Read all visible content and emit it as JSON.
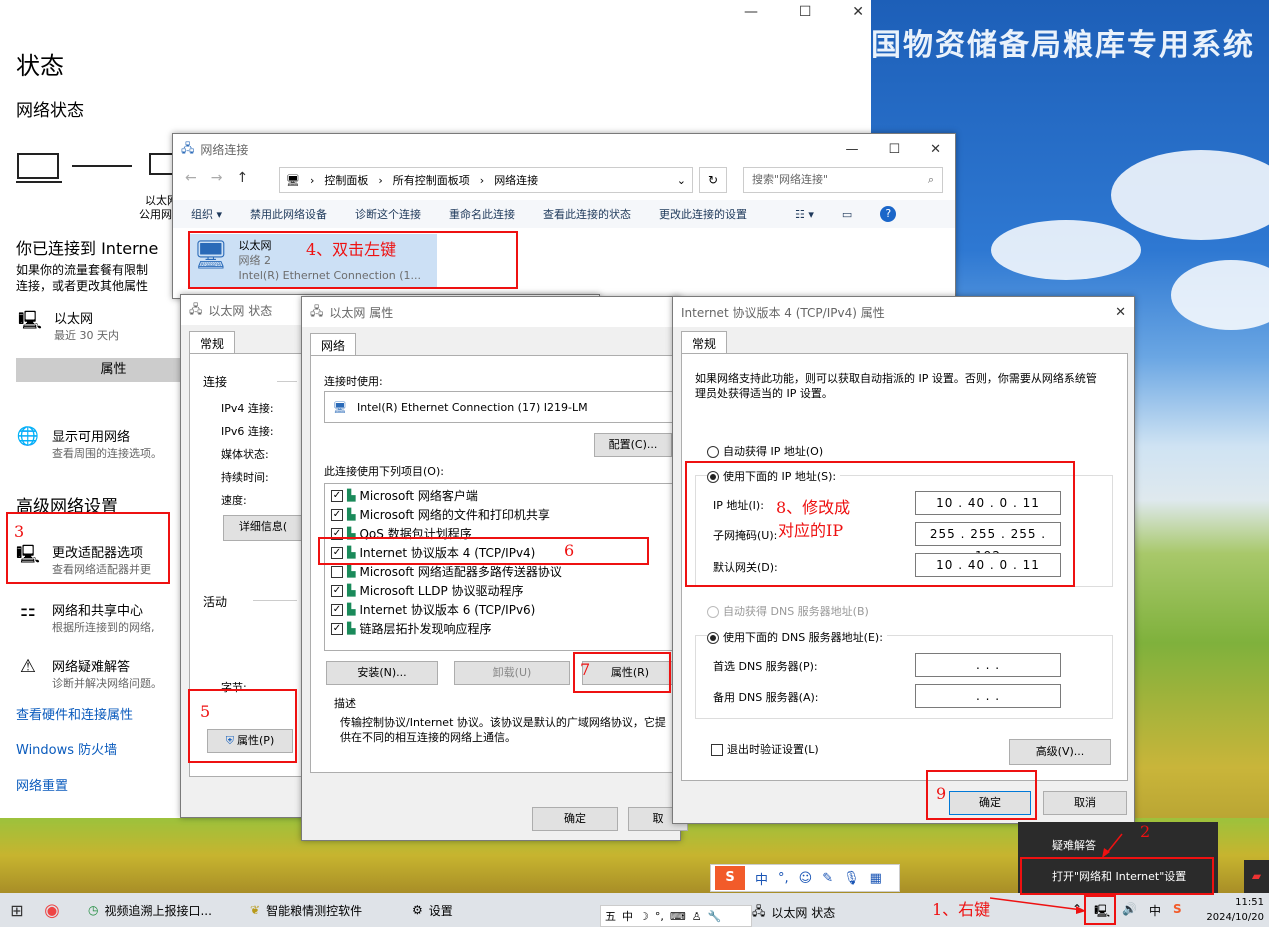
{
  "banner": "国物资储备局粮库专用系统",
  "settings": {
    "heading": "状态",
    "network_status": "网络状态",
    "adapter_label": "以太网",
    "adapter_sub": "公用网",
    "connected_heading": "你已连接到 Interne",
    "connected_desc1": "如果你的流量套餐有限制",
    "connected_desc2": "连接，或者更改其他属性",
    "eth_name": "以太网",
    "eth_sub": "最近 30 天内",
    "props_btn": "属性",
    "show_networks": "显示可用网络",
    "show_networks_sub": "查看周围的连接选项。",
    "advanced_heading": "高级网络设置",
    "change_adapter": "更改适配器选项",
    "change_adapter_sub": "查看网络适配器并更",
    "sharing_center": "网络和共享中心",
    "sharing_center_sub": "根据所连接到的网络,",
    "troubleshoot": "网络疑难解答",
    "troubleshoot_sub": "诊断并解决网络问题。",
    "link_hw": "查看硬件和连接属性",
    "link_firewall": "Windows 防火墙",
    "link_reset": "网络重置"
  },
  "netconn": {
    "title": "网络连接",
    "breadcrumb": [
      "控制面板",
      "所有控制面板项",
      "网络连接"
    ],
    "search_placeholder": "搜索\"网络连接\"",
    "toolbar": [
      "组织 ▾",
      "禁用此网络设备",
      "诊断这个连接",
      "重命名此连接",
      "查看此连接的状态",
      "更改此连接的设置"
    ],
    "adapter": {
      "name": "以太网",
      "net": "网络 2",
      "device": "Intel(R) Ethernet Connection (1..."
    }
  },
  "status_win": {
    "title": "以太网 状态",
    "tab": "常规",
    "group_conn": "连接",
    "rows": [
      "IPv4 连接:",
      "IPv6 连接:",
      "媒体状态:",
      "持续时间:",
      "速度:"
    ],
    "details_btn": "详细信息(",
    "group_activity": "活动",
    "bytes": "字节:",
    "props_btn": "属性(P)"
  },
  "props_win": {
    "title": "以太网 属性",
    "tab": "网络",
    "connect_using": "连接时使用:",
    "device": "Intel(R) Ethernet Connection (17) I219-LM",
    "config_btn": "配置(C)...",
    "items_label": "此连接使用下列项目(O):",
    "items": [
      {
        "checked": true,
        "label": "Microsoft 网络客户端"
      },
      {
        "checked": true,
        "label": "Microsoft 网络的文件和打印机共享"
      },
      {
        "checked": true,
        "label": "QoS 数据包计划程序"
      },
      {
        "checked": true,
        "label": "Internet 协议版本 4 (TCP/IPv4)"
      },
      {
        "checked": false,
        "label": "Microsoft 网络适配器多路传送器协议"
      },
      {
        "checked": true,
        "label": "Microsoft LLDP 协议驱动程序"
      },
      {
        "checked": true,
        "label": "Internet 协议版本 6 (TCP/IPv6)"
      },
      {
        "checked": true,
        "label": "链路层拓扑发现响应程序"
      }
    ],
    "install_btn": "安装(N)...",
    "uninstall_btn": "卸载(U)",
    "props_btn": "属性(R)",
    "desc_label": "描述",
    "desc": "传输控制协议/Internet 协议。该协议是默认的广域网络协议，它提供在不同的相互连接的网络上通信。",
    "ok_btn": "确定",
    "cancel_btn": "取"
  },
  "ipv4": {
    "title": "Internet 协议版本 4 (TCP/IPv4) 属性",
    "tab": "常规",
    "intro": "如果网络支持此功能，则可以获取自动指派的 IP 设置。否则，你需要从网络系统管理员处获得适当的 IP 设置。",
    "auto_ip": "自动获得 IP 地址(O)",
    "manual_ip": "使用下面的 IP 地址(S):",
    "ip_label": "IP 地址(I):",
    "mask_label": "子网掩码(U):",
    "gw_label": "默认网关(D):",
    "ip": "10 . 40 . 0 . 11",
    "mask": "255 . 255 . 255 . 192",
    "gw": "10 . 40 . 0 . 11",
    "auto_dns": "自动获得 DNS 服务器地址(B)",
    "manual_dns": "使用下面的 DNS 服务器地址(E):",
    "dns1_label": "首选 DNS 服务器(P):",
    "dns2_label": "备用 DNS 服务器(A):",
    "dns_empty": ".      .      .",
    "validate": "退出时验证设置(L)",
    "advanced_btn": "高级(V)...",
    "ok_btn": "确定",
    "cancel_btn": "取消"
  },
  "tray_menu": {
    "troubleshoot": "疑难解答",
    "open_settings": "打开\"网络和 Internet\"设置"
  },
  "annotations": {
    "a1": "1、右键",
    "a2": "2",
    "a3": "3",
    "a4": "4、双击左键",
    "a5": "5",
    "a6": "6",
    "a7": "7",
    "a8": "8、修改成",
    "a8b": "对应的IP",
    "a9": "9"
  },
  "taskbar": {
    "apps": [
      "视频追溯上报接口...",
      "智能粮情测控软件",
      "设置",
      "以太网 状态"
    ],
    "time": "11:51",
    "date": "2024/10/20",
    "ime": "中"
  },
  "colors": {
    "annotation": "#e11",
    "link": "#0a5bbd",
    "taskbar": "#dfe3e8"
  }
}
